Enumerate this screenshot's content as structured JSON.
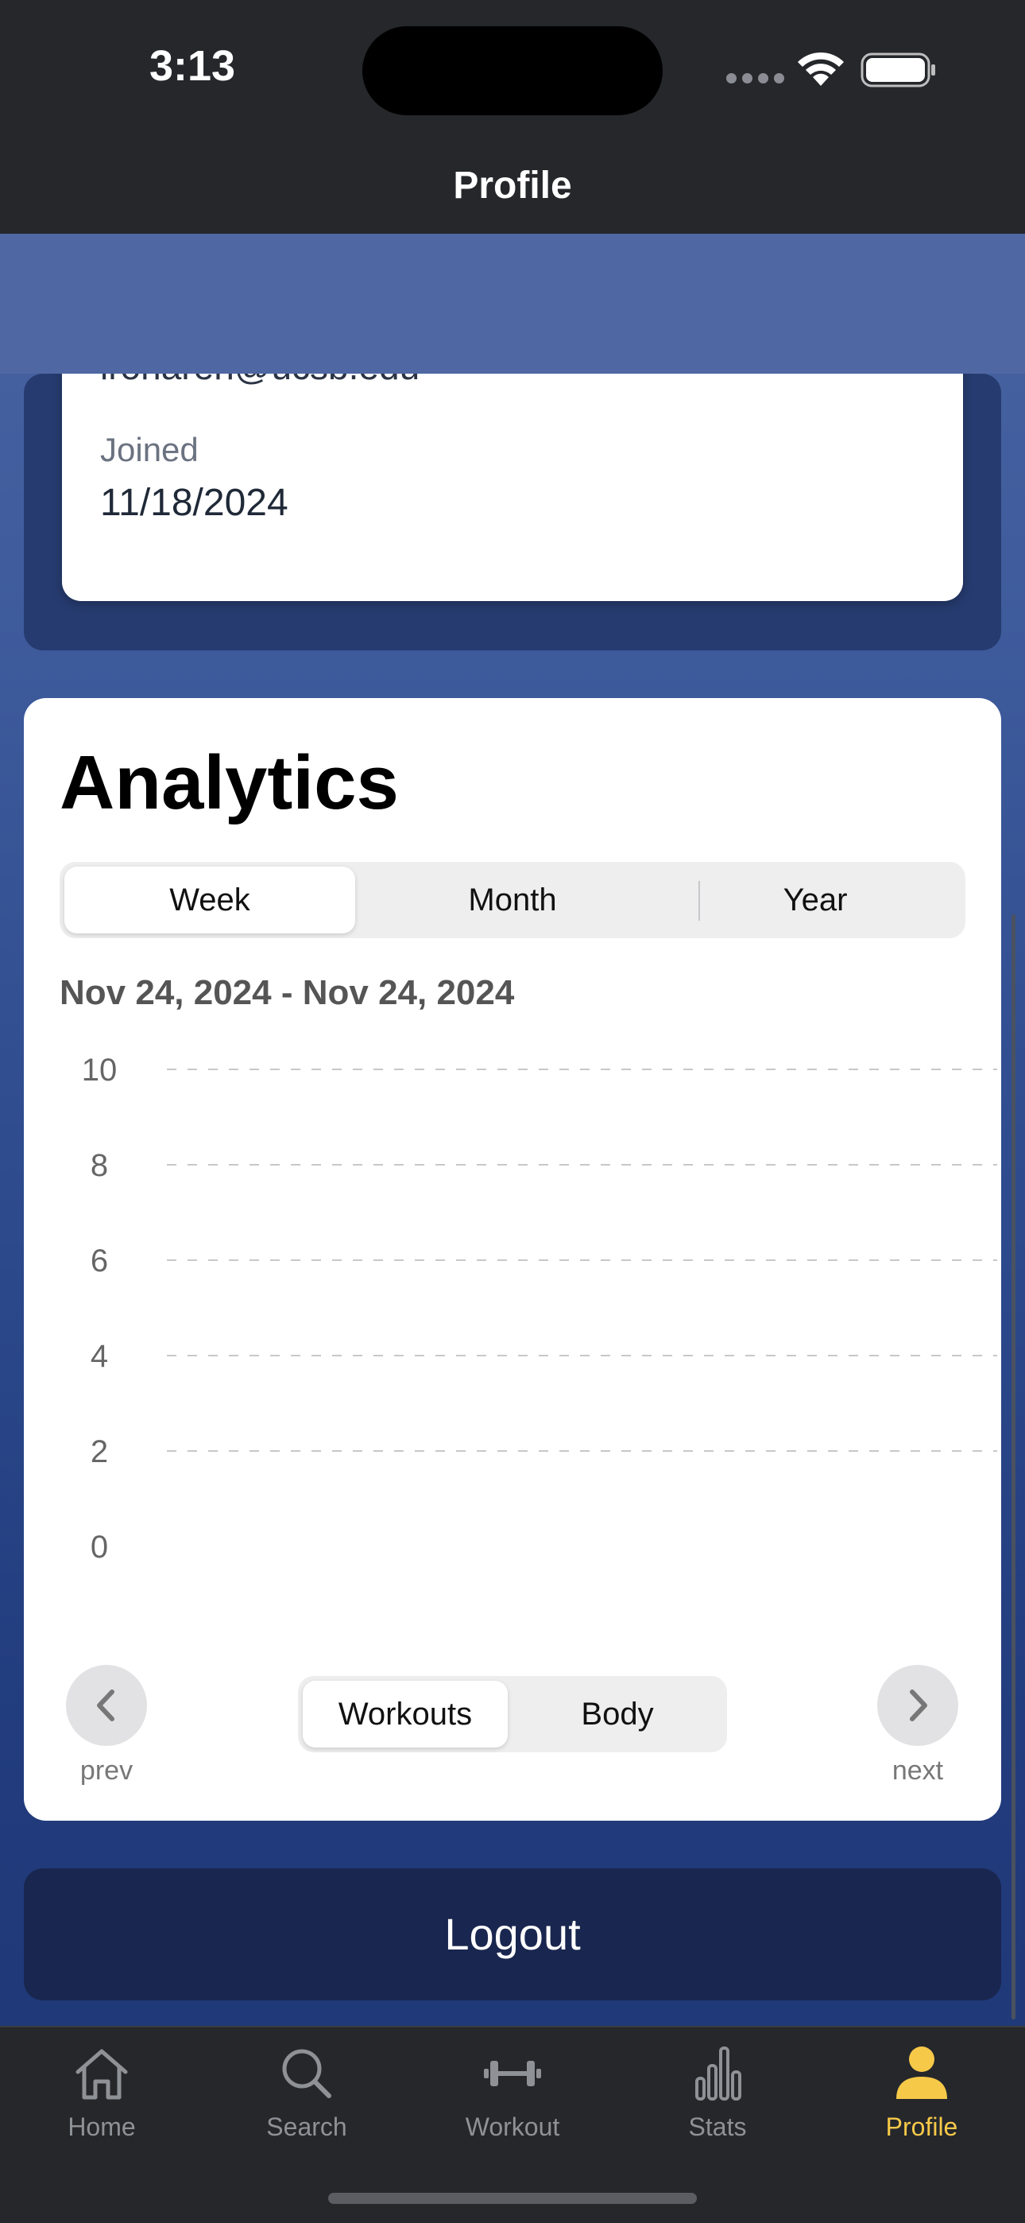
{
  "status": {
    "time": "3:13"
  },
  "header": {
    "title": "Profile"
  },
  "profile": {
    "email": "lrohareh@ucsb.edu",
    "joined_label": "Joined",
    "joined_value": "11/18/2024"
  },
  "analytics": {
    "title": "Analytics",
    "period_tabs": [
      "Week",
      "Month",
      "Year"
    ],
    "selected_period": "Week",
    "date_range": "Nov 24, 2024 - Nov 24, 2024",
    "prev_label": "prev",
    "next_label": "next",
    "mode_tabs": [
      "Workouts",
      "Body"
    ],
    "selected_mode": "Workouts"
  },
  "chart_data": {
    "type": "bar",
    "categories": [],
    "values": [],
    "y_ticks": [
      "10",
      "8",
      "6",
      "4",
      "2",
      "0"
    ],
    "ylim": [
      0,
      10
    ],
    "grid": true
  },
  "logout": {
    "label": "Logout"
  },
  "tabbar": {
    "items": [
      {
        "label": "Home",
        "icon": "home-icon"
      },
      {
        "label": "Search",
        "icon": "search-icon"
      },
      {
        "label": "Workout",
        "icon": "dumbbell-icon"
      },
      {
        "label": "Stats",
        "icon": "bar-chart-icon"
      },
      {
        "label": "Profile",
        "icon": "person-icon"
      }
    ],
    "active": "Profile",
    "active_color": "#f7c948",
    "inactive_color": "#8e9196"
  }
}
